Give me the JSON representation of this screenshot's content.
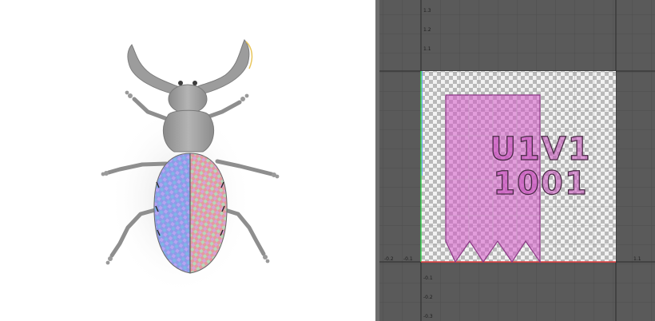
{
  "uv_editor": {
    "tile_label_line1": "U1V1",
    "tile_label_line2": "1001",
    "v_ticks": [
      "1.3",
      "1.2",
      "1.1",
      "-0.1",
      "-0.2",
      "-0.3"
    ],
    "u_ticks": [
      "-0.2",
      "-0.1",
      "1.1"
    ]
  },
  "colors": {
    "editor_background": "#5a5a5a",
    "uv_shell_fill": "#d658c8",
    "u_axis": "#e23a3a",
    "v_axis": "#2fd24a"
  }
}
